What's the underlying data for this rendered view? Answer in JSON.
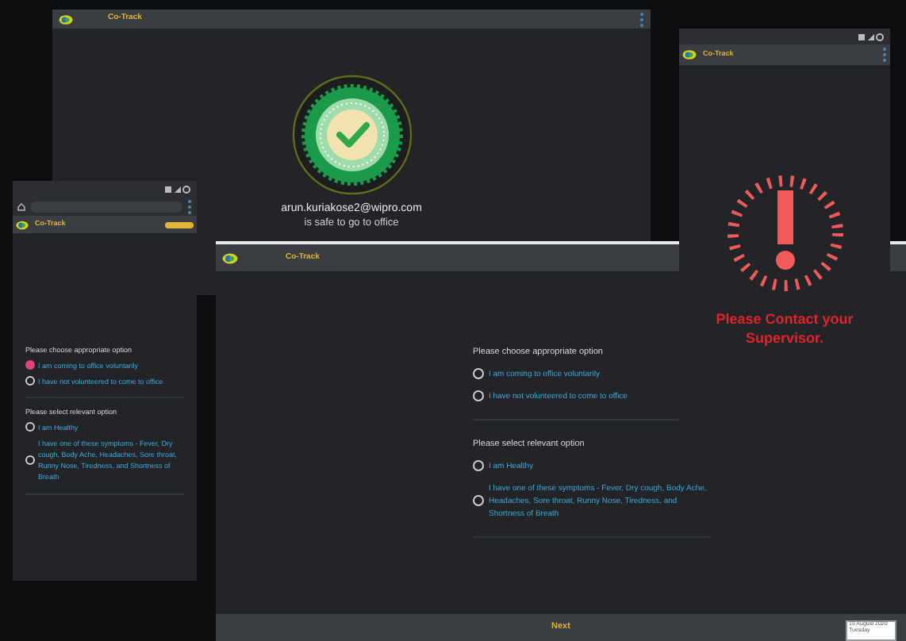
{
  "windows": [
    {
      "kind": "safe",
      "title": "Co-Track",
      "email": "arun.kuriakose2@wipro.com",
      "message": "is safe to go to office"
    },
    {
      "kind": "mobile_form",
      "title": "Co-Track",
      "sections": [
        {
          "prompt": "Please choose appropriate option",
          "options": [
            {
              "label": "I am coming to office voluntarily",
              "selected": true
            },
            {
              "label": "I have not volunteered to come to office",
              "selected": false
            }
          ]
        },
        {
          "prompt": "Please select relevant option",
          "options": [
            {
              "label": "I am Healthy",
              "selected": false
            },
            {
              "label": "I have one of these symptoms - Fever, Dry cough, Body Ache, Headaches, Sore throat, Runny Nose, Tiredness, and Shortness of Breath",
              "selected": false
            }
          ]
        }
      ]
    },
    {
      "kind": "form",
      "title": "Co-Track",
      "sections": [
        {
          "prompt": "Please choose appropriate option",
          "options": [
            {
              "label": "I am coming to office voluntarily",
              "selected": false
            },
            {
              "label": "I have not volunteered to come to office",
              "selected": false
            }
          ]
        },
        {
          "prompt": "Please select relevant option",
          "options": [
            {
              "label": "I am Healthy",
              "selected": false
            },
            {
              "label": "I have one of these symptoms - Fever, Dry cough, Body Ache, Headaches, Sore throat, Runny Nose, Tiredness, and Shortness of Breath",
              "selected": false
            }
          ]
        }
      ],
      "next_button": "Next",
      "date": "15 August 2020",
      "day": "Tuesday"
    },
    {
      "kind": "alert",
      "title": "Co-Track",
      "message": "Please Contact your Supervisor."
    }
  ]
}
